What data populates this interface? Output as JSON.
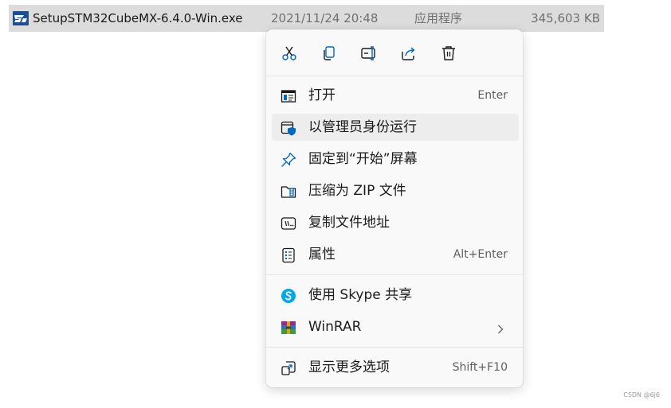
{
  "file": {
    "name": "SetupSTM32CubeMX-6.4.0-Win.exe",
    "modified": "2021/11/24 20:48",
    "type": "应用程序",
    "size": "345,603 KB",
    "icon": "st-logo-icon"
  },
  "toolbar": {
    "cut_icon": "scissors-icon",
    "copy_icon": "copy-icon",
    "rename_icon": "rename-icon",
    "share_icon": "share-icon",
    "delete_icon": "trash-icon"
  },
  "menu": {
    "items": [
      {
        "label": "打开",
        "shortcut": "Enter",
        "icon": "open-window-icon"
      },
      {
        "label": "以管理员身份运行",
        "shortcut": "",
        "icon": "admin-shield-icon"
      },
      {
        "label": "固定到“开始”屏幕",
        "shortcut": "",
        "icon": "pin-icon"
      },
      {
        "label": "压缩为 ZIP 文件",
        "shortcut": "",
        "icon": "zip-folder-icon"
      },
      {
        "label": "复制文件地址",
        "shortcut": "",
        "icon": "copy-path-icon"
      },
      {
        "label": "属性",
        "shortcut": "Alt+Enter",
        "icon": "properties-icon"
      },
      {
        "label": "使用 Skype 共享",
        "shortcut": "",
        "icon": "skype-icon"
      },
      {
        "label": "WinRAR",
        "shortcut": "",
        "icon": "winrar-icon"
      },
      {
        "label": "显示更多选项",
        "shortcut": "Shift+F10",
        "icon": "more-options-icon"
      }
    ]
  },
  "watermark": "CSDN @6j6",
  "colors": {
    "selection": "#dcdcdc",
    "menu_bg": "#f9f9f9",
    "hover": "#ededed",
    "accent": "#0067c0",
    "skype": "#00a8e6"
  }
}
